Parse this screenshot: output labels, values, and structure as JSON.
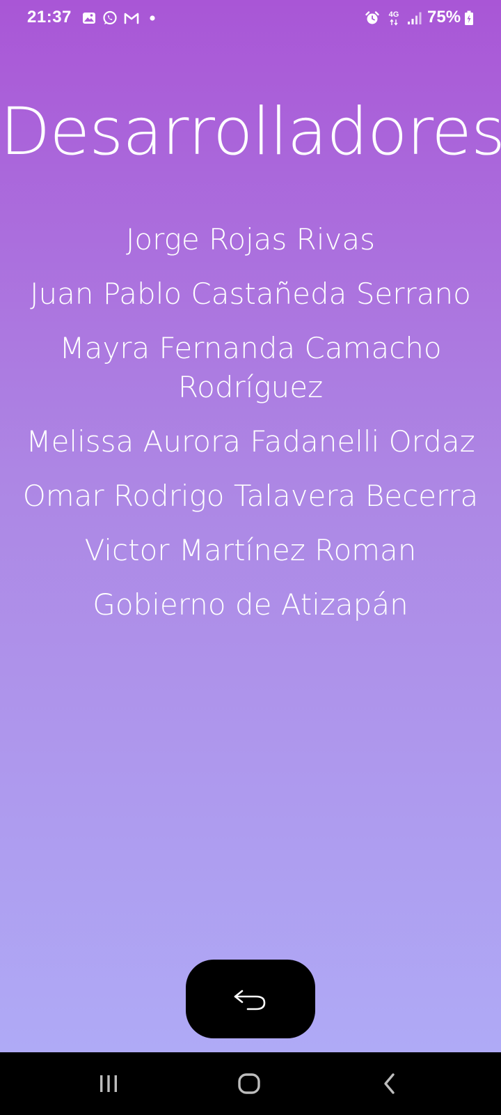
{
  "status_bar": {
    "time": "21:37",
    "network_label": "4G",
    "battery": "75%",
    "icons": [
      "image-icon",
      "whatsapp-icon",
      "gmail-icon",
      "notification-dot-icon",
      "alarm-icon",
      "network-4g-icon",
      "signal-icon",
      "battery-icon"
    ]
  },
  "page": {
    "title": "Desarrolladores"
  },
  "developers": [
    "Jorge Rojas Rivas",
    "Juan Pablo Castañeda Serrano",
    "Mayra Fernanda Camacho Rodríguez",
    "Melissa Aurora Fadanelli Ordaz",
    "Omar Rodrigo Talavera Becerra",
    "Victor Martínez Roman",
    "Gobierno de Atizapán"
  ],
  "back_button": {
    "icon": "undo-arrow-icon"
  },
  "nav_bar": {
    "buttons": [
      "recents-icon",
      "home-icon",
      "back-icon"
    ]
  },
  "colors": {
    "gradient_top": "#a956d6",
    "gradient_bottom": "#afaaf6",
    "text": "#ffffff",
    "button": "#000000"
  }
}
